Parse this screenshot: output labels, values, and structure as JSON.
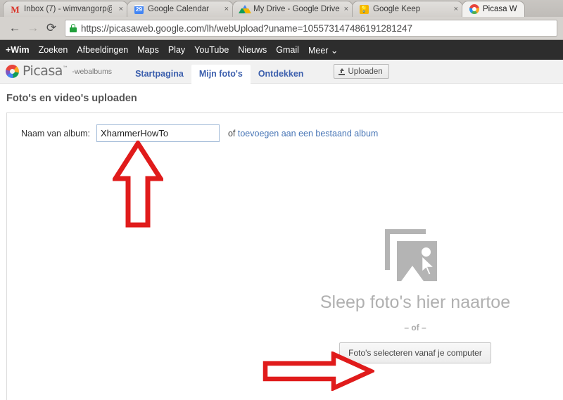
{
  "browser": {
    "tabs": [
      {
        "title": "Inbox (7) - wimvangorp@",
        "favicon": "gmail-icon",
        "active": false,
        "close_label": "×"
      },
      {
        "title": "Google Calendar",
        "favicon": "calendar-icon",
        "favicon_text": "29",
        "active": false,
        "close_label": "×"
      },
      {
        "title": "My Drive - Google Drive",
        "favicon": "drive-icon",
        "active": false,
        "close_label": "×"
      },
      {
        "title": "Google Keep",
        "favicon": "keep-icon",
        "favicon_text": "☰",
        "active": false,
        "close_label": "×"
      },
      {
        "title": "Picasa W",
        "favicon": "picasa-icon",
        "active": true,
        "close_label": ""
      }
    ],
    "nav": {
      "back_label": "←",
      "forward_label": "→",
      "reload_label": "⟳"
    },
    "omnibox": {
      "url": "https://picasaweb.google.com/lh/webUpload?uname=105573147486191281247",
      "secure_icon": "lock-icon"
    }
  },
  "gbar": {
    "items": [
      {
        "label": "+Wim",
        "bold": true
      },
      {
        "label": "Zoeken"
      },
      {
        "label": "Afbeeldingen"
      },
      {
        "label": "Maps"
      },
      {
        "label": "Play"
      },
      {
        "label": "YouTube"
      },
      {
        "label": "Nieuws"
      },
      {
        "label": "Gmail"
      },
      {
        "label": "Meer ⌄"
      }
    ]
  },
  "picasa": {
    "wordmark": "Picasa",
    "trademark": "™",
    "subtitle": "-webalbums",
    "tabs": [
      {
        "label": "Startpagina",
        "active": false
      },
      {
        "label": "Mijn foto's",
        "active": true
      },
      {
        "label": "Ontdekken",
        "active": false
      }
    ],
    "upload_button": "Uploaden"
  },
  "page": {
    "title": "Foto's en video's uploaden",
    "album": {
      "label": "Naam van album:",
      "value": "XhammerHowTo",
      "suffix_prefix": "of ",
      "suffix_link": "toevoegen aan een bestaand album"
    },
    "dropzone": {
      "icon": "photo-stack-cursor-icon",
      "text": "Sleep foto's hier naartoe",
      "or_text": "– of –",
      "select_button": "Foto's selecteren vanaf je computer"
    },
    "annotations": [
      {
        "name": "arrow-up",
        "direction": "up",
        "color": "#e01b1b"
      },
      {
        "name": "arrow-right",
        "direction": "right",
        "color": "#e01b1b"
      }
    ]
  },
  "colors": {
    "annotation_red": "#e01b1b",
    "link_blue": "#4674b5",
    "tab_blue": "#3c5fad",
    "gbar_bg": "#2d2d2d"
  }
}
